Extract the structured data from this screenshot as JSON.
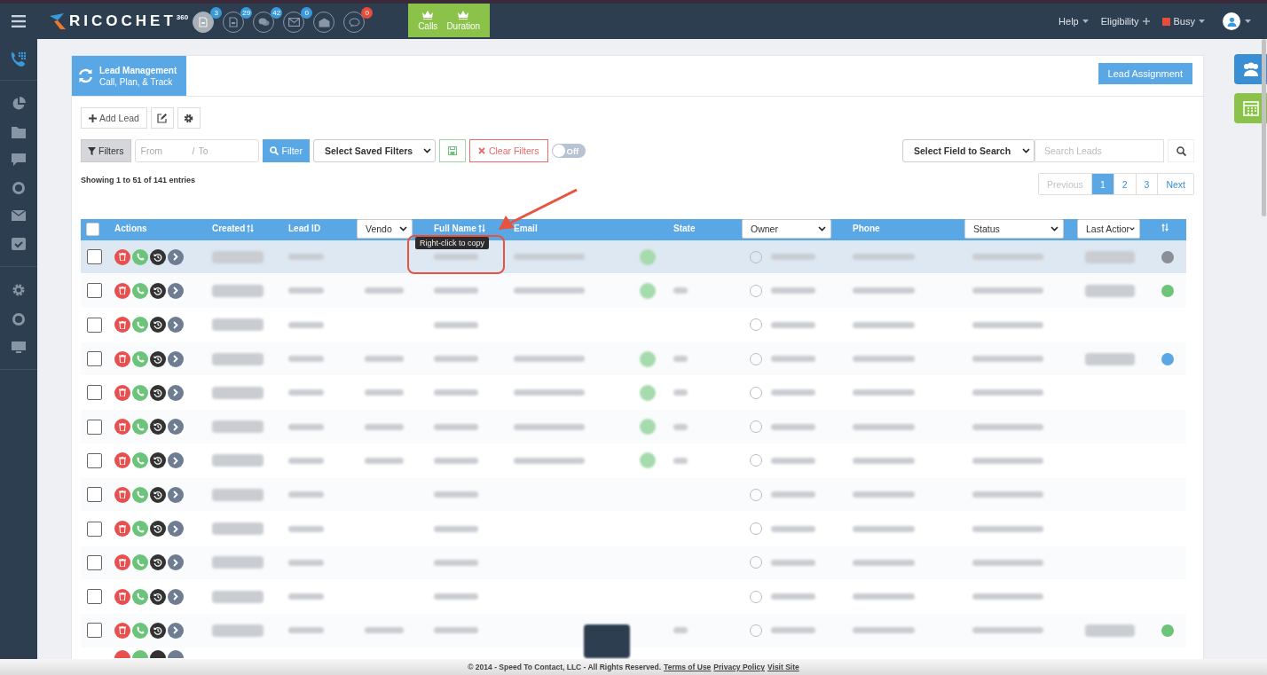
{
  "topbar": {
    "brand": "RICOCHET",
    "brand_sup": "360",
    "quick_icons": [
      {
        "kind": "sms",
        "badge": "3",
        "color": "#3a9ad9",
        "selected": true
      },
      {
        "kind": "sms",
        "badge": "29",
        "color": "#3a9ad9",
        "selected": false
      },
      {
        "kind": "chat",
        "badge": "42",
        "color": "#3a9ad9",
        "selected": false
      },
      {
        "kind": "mail",
        "badge": "0",
        "color": "#3a9ad9",
        "selected": false
      },
      {
        "kind": "open-mail",
        "selected": false
      },
      {
        "kind": "bubble",
        "badge": "0",
        "color": "#e74c3c",
        "selected": false
      }
    ],
    "leaderboard": [
      "Calls",
      "Duration"
    ],
    "menu": [
      {
        "label": "Help",
        "kind": "dropdown"
      },
      {
        "label": "Eligibility",
        "kind": "plus"
      },
      {
        "label": "Busy",
        "kind": "status",
        "color": "#e74c3c"
      }
    ]
  },
  "panel": {
    "title": "Lead Management",
    "subtitle": "Call, Plan, & Track",
    "assign_button": "Lead Assignment"
  },
  "toolbar": {
    "add_button": "Add Lead"
  },
  "filters": {
    "filters_button": "Filters",
    "from_placeholder": "From",
    "separator": "/",
    "to_placeholder": "To",
    "filter_button": "Filter",
    "saved_filters": "Select Saved Filters",
    "clear_button": "Clear Filters",
    "toggle": {
      "label": "Off",
      "on": false
    },
    "search_field_select": "Select Field to Search",
    "search_placeholder": "Search Leads"
  },
  "info": "Showing 1 to 51 of 141 entries",
  "pagination": [
    {
      "label": "Previous",
      "disabled": true,
      "selected": false
    },
    {
      "label": "1",
      "disabled": false,
      "selected": true
    },
    {
      "label": "2",
      "disabled": false,
      "selected": false
    },
    {
      "label": "3",
      "disabled": false,
      "selected": false
    },
    {
      "label": "Next",
      "disabled": false,
      "selected": false
    }
  ],
  "table": {
    "select_all": {
      "checked": false
    },
    "columns": [
      {
        "kind": "checkbox"
      },
      {
        "kind": "text",
        "label": "Actions"
      },
      {
        "kind": "sort",
        "label": "Created"
      },
      {
        "kind": "text",
        "label": "Lead ID"
      },
      {
        "kind": "select",
        "label": "Vendo"
      },
      {
        "kind": "sort",
        "label": "Full Name"
      },
      {
        "kind": "text",
        "label": "Email"
      },
      {
        "kind": "blank"
      },
      {
        "kind": "text",
        "label": "State"
      },
      {
        "kind": "select",
        "label": "Owner"
      },
      {
        "kind": "text",
        "label": "Phone"
      },
      {
        "kind": "select",
        "label": "Status"
      },
      {
        "kind": "select",
        "label": "Last Actior"
      },
      {
        "kind": "sorticon"
      }
    ],
    "rows": [
      {
        "selected": true,
        "checked": false,
        "color": "#8a8f98"
      },
      {
        "selected": false,
        "checked": false,
        "color": "#6cc47a"
      },
      {
        "selected": false,
        "checked": false
      },
      {
        "selected": false,
        "checked": false,
        "color": "#5aa7e6"
      },
      {
        "selected": false,
        "checked": false
      },
      {
        "selected": false,
        "checked": false
      },
      {
        "selected": false,
        "checked": false
      },
      {
        "selected": false,
        "checked": false
      },
      {
        "selected": false,
        "checked": false
      },
      {
        "selected": false,
        "checked": false
      },
      {
        "selected": false,
        "checked": false
      },
      {
        "selected": false,
        "checked": false,
        "color": "#6cc47a"
      }
    ]
  },
  "tooltip": "Right-click to copy",
  "footer": {
    "text": "© 2014 - Speed To Contact, LLC - All Rights Reserved.",
    "links": [
      "Terms of Use",
      "Privacy Policy",
      "Visit Site"
    ]
  }
}
